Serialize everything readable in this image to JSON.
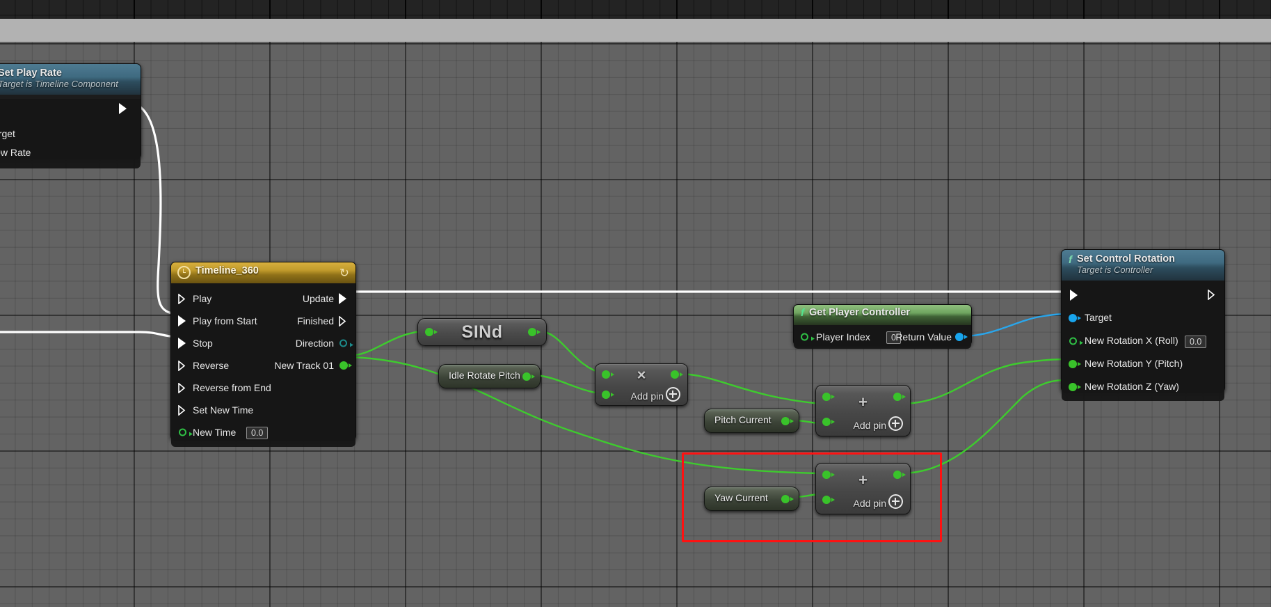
{
  "app": {
    "context": "Unreal Engine Blueprint Event Graph",
    "background_color": "#636363",
    "grid_line_color": "#4e4e4e"
  },
  "colors": {
    "exec_wire": "#ffffff",
    "data_wire_float": "#39c32a",
    "data_wire_object": "#18a4ec",
    "selection_rect": "#ff1111",
    "function_header": "#3f6a80",
    "pure_function_header": "#6fa55f",
    "timeline_header": "#c09a2b"
  },
  "nodes": [
    {
      "id": "set-play-rate",
      "title": "Set Play Rate",
      "subtitle": "Target is Timeline Component",
      "header_style": "function",
      "icon": "function-f-icon",
      "inputs": [
        {
          "label": "",
          "type": "exec"
        },
        {
          "label": "Target",
          "type": "object"
        },
        {
          "label": "New Rate",
          "type": "float"
        }
      ],
      "outputs": [
        {
          "label": "",
          "type": "exec"
        }
      ]
    },
    {
      "id": "timeline-360",
      "title": "Timeline_360",
      "header_style": "timeline",
      "icon": "clock-icon",
      "corner_icon": "loop-icon",
      "inputs": [
        {
          "label": "Play",
          "type": "exec"
        },
        {
          "label": "Play from Start",
          "type": "exec"
        },
        {
          "label": "Stop",
          "type": "exec"
        },
        {
          "label": "Reverse",
          "type": "exec"
        },
        {
          "label": "Reverse from End",
          "type": "exec"
        },
        {
          "label": "Set New Time",
          "type": "exec"
        },
        {
          "label": "New Time",
          "type": "float",
          "value": "0.0"
        }
      ],
      "outputs": [
        {
          "label": "Update",
          "type": "exec"
        },
        {
          "label": "Finished",
          "type": "exec"
        },
        {
          "label": "Direction",
          "type": "enum"
        },
        {
          "label": "New Track 01",
          "type": "float"
        }
      ]
    },
    {
      "id": "sin-d",
      "title": "SINd",
      "header_style": "compact-pure",
      "inputs": [
        {
          "label": "",
          "type": "float"
        }
      ],
      "outputs": [
        {
          "label": "",
          "type": "float"
        }
      ]
    },
    {
      "id": "idle-rotate-pitch",
      "title": "Idle Rotate Pitch",
      "header_style": "variable-getter",
      "outputs": [
        {
          "label": "",
          "type": "float"
        }
      ]
    },
    {
      "id": "multiply",
      "title": "",
      "operator": "×",
      "add_pin_label": "Add pin",
      "header_style": "compact-math",
      "inputs": [
        {
          "type": "float"
        },
        {
          "type": "float"
        }
      ],
      "outputs": [
        {
          "type": "float"
        }
      ]
    },
    {
      "id": "get-player-controller",
      "title": "Get Player Controller",
      "header_style": "pure-function",
      "icon": "function-f-icon",
      "inputs": [
        {
          "label": "Player Index",
          "type": "int",
          "value": "0"
        }
      ],
      "outputs": [
        {
          "label": "Return Value",
          "type": "object"
        }
      ]
    },
    {
      "id": "pitch-current",
      "title": "Pitch Current",
      "header_style": "variable-getter",
      "outputs": [
        {
          "label": "",
          "type": "float"
        }
      ]
    },
    {
      "id": "add-pitch",
      "title": "",
      "operator": "+",
      "add_pin_label": "Add pin",
      "header_style": "compact-math",
      "inputs": [
        {
          "type": "float"
        },
        {
          "type": "float"
        }
      ],
      "outputs": [
        {
          "type": "float"
        }
      ]
    },
    {
      "id": "yaw-current",
      "title": "Yaw Current",
      "header_style": "variable-getter",
      "outputs": [
        {
          "label": "",
          "type": "float"
        }
      ]
    },
    {
      "id": "add-yaw",
      "title": "",
      "operator": "+",
      "add_pin_label": "Add pin",
      "header_style": "compact-math",
      "inputs": [
        {
          "type": "float"
        },
        {
          "type": "float"
        }
      ],
      "outputs": [
        {
          "type": "float"
        }
      ]
    },
    {
      "id": "set-control-rotation",
      "title": "Set Control Rotation",
      "subtitle": "Target is Controller",
      "header_style": "function",
      "icon": "function-f-icon",
      "inputs": [
        {
          "label": "",
          "type": "exec"
        },
        {
          "label": "Target",
          "type": "object"
        },
        {
          "label": "New Rotation X (Roll)",
          "type": "float",
          "value": "0.0"
        },
        {
          "label": "New Rotation Y (Pitch)",
          "type": "float"
        },
        {
          "label": "New Rotation Z (Yaw)",
          "type": "float"
        }
      ],
      "outputs": [
        {
          "label": "",
          "type": "exec"
        }
      ]
    }
  ],
  "set_play_rate": {
    "title": "Set Play Rate",
    "subtitle": "Target is Timeline Component",
    "target_label": "Target",
    "new_rate_label": "New Rate"
  },
  "timeline": {
    "title": "Timeline_360",
    "in": {
      "play": "Play",
      "play_from_start": "Play from Start",
      "stop": "Stop",
      "reverse": "Reverse",
      "reverse_from_end": "Reverse from End",
      "set_new_time": "Set New Time",
      "new_time": "New Time",
      "new_time_value": "0.0"
    },
    "out": {
      "update": "Update",
      "finished": "Finished",
      "direction": "Direction",
      "new_track_01": "New Track 01"
    }
  },
  "sin_node": {
    "label": "SINd"
  },
  "idle_rotate_pitch": {
    "label": "Idle Rotate Pitch"
  },
  "multiply_node": {
    "operator": "×",
    "add_pin": "Add pin"
  },
  "add_pitch_node": {
    "operator": "+",
    "add_pin": "Add pin"
  },
  "add_yaw_node": {
    "operator": "+",
    "add_pin": "Add pin"
  },
  "pitch_current": {
    "label": "Pitch Current"
  },
  "yaw_current": {
    "label": "Yaw Current"
  },
  "get_player_controller": {
    "title": "Get Player Controller",
    "player_index": "Player Index",
    "player_index_value": "0",
    "return_value": "Return Value"
  },
  "set_control_rotation": {
    "title": "Set Control Rotation",
    "subtitle": "Target is Controller",
    "target": "Target",
    "roll": "New Rotation X (Roll)",
    "roll_value": "0.0",
    "pitch": "New Rotation Y (Pitch)",
    "yaw": "New Rotation Z (Yaw)"
  }
}
